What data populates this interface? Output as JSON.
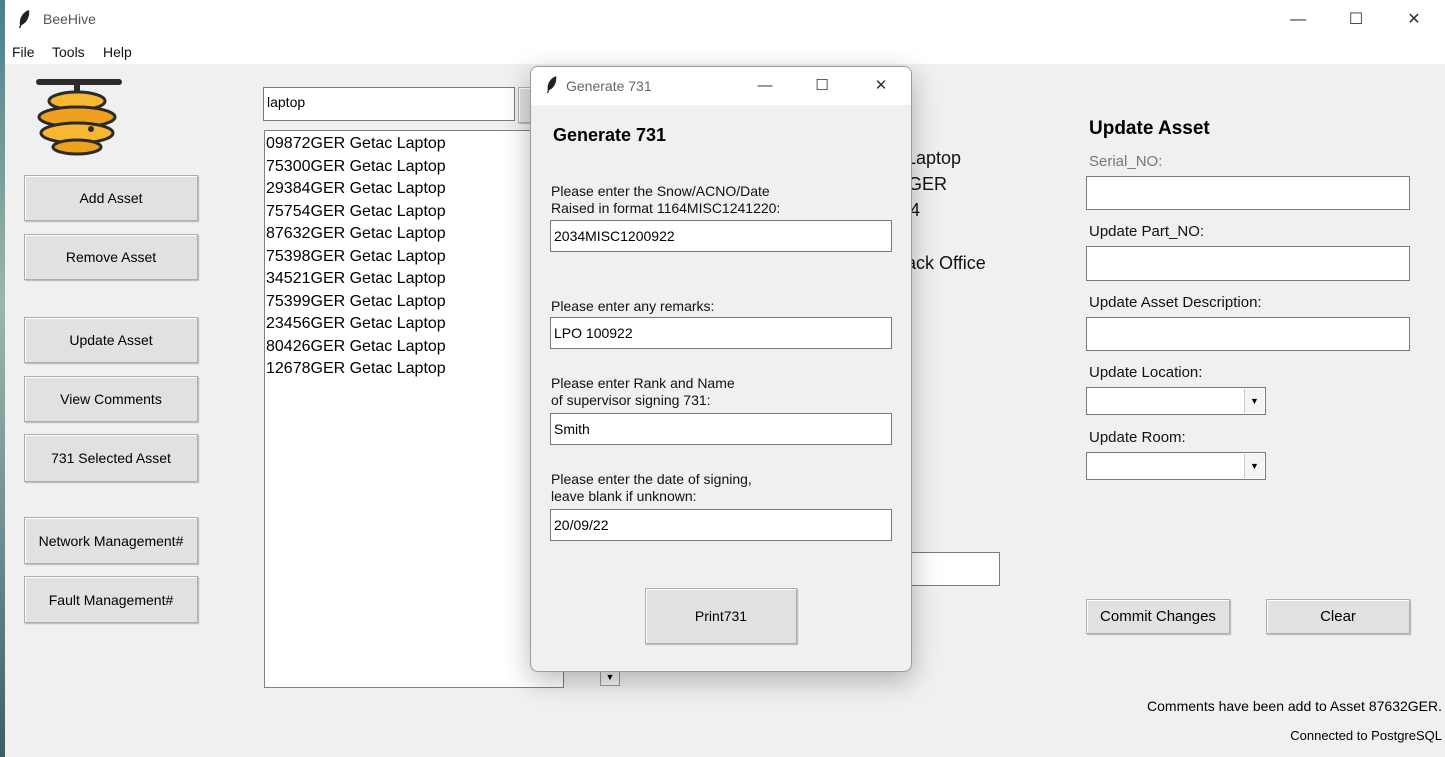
{
  "window": {
    "title": "BeeHive"
  },
  "menu": {
    "file": "File",
    "tools": "Tools",
    "help": "Help"
  },
  "sidebar": {
    "add_asset": "Add Asset",
    "remove_asset": "Remove Asset",
    "update_asset": "Update Asset",
    "view_comments": "View Comments",
    "selected_731": "731 Selected Asset",
    "network_mgmt": "Network Management#",
    "fault_mgmt": "Fault Management#"
  },
  "search": {
    "value": "laptop"
  },
  "asset_list": [
    "09872GER Getac Laptop",
    "75300GER Getac Laptop",
    "29384GER Getac Laptop",
    "75754GER Getac Laptop",
    "87632GER Getac Laptop",
    "75398GER Getac Laptop",
    "34521GER Getac Laptop",
    "75399GER Getac Laptop",
    "23456GER Getac Laptop",
    "80426GER Getac Laptop",
    "12678GER Getac Laptop"
  ],
  "details_partial": {
    "line1": "Laptop",
    "line2": "GER",
    "line3": "4",
    "line4": "ack Office"
  },
  "update_panel": {
    "title": "Update Asset",
    "serial_label": "Serial_NO:",
    "part_label": "Update Part_NO:",
    "desc_label": "Update Asset Description:",
    "location_label": "Update Location:",
    "room_label": "Update Room:",
    "commit": "Commit Changes",
    "clear": "Clear"
  },
  "status": {
    "message": "Comments have been add to Asset 87632GER.",
    "connection": "Connected to PostgreSQL"
  },
  "dialog": {
    "title": "Generate 731",
    "heading": "Generate 731",
    "snow_label": "Please enter the Snow/ACNO/Date\nRaised in format 1164MISC1241220:",
    "snow_value": "2034MISC1200922",
    "remarks_label": "Please enter any remarks:",
    "remarks_value": "LPO 100922",
    "rank_label": "Please enter Rank and Name\nof supervisor signing 731:",
    "rank_value": "Smith",
    "date_label": "Please enter the date of signing,\nleave blank if unknown:",
    "date_value": "20/09/22",
    "print": "Print731"
  }
}
